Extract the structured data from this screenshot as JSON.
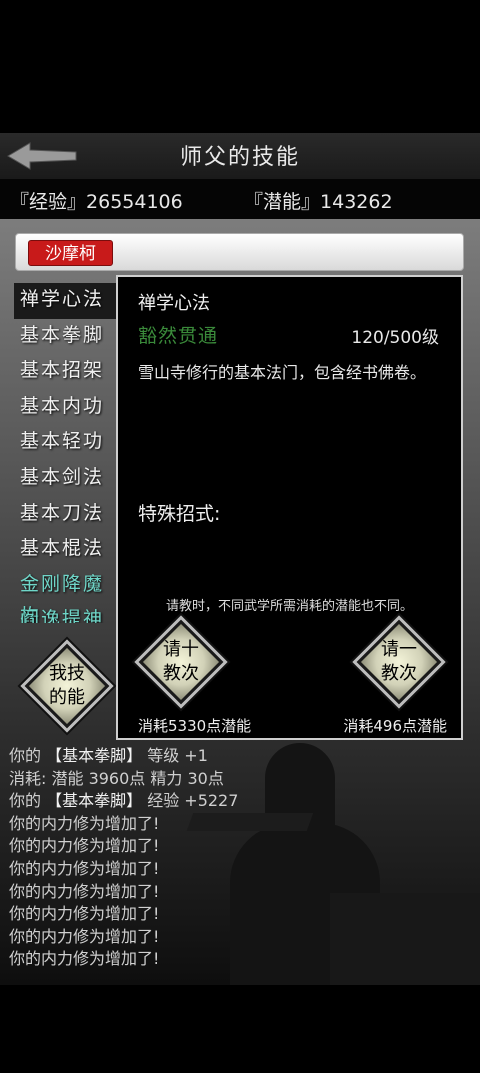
{
  "header": {
    "title": "师父的技能"
  },
  "stats": {
    "exp_label": "『经验』",
    "exp_value": "26554106",
    "pot_label": "『潜能』",
    "pot_value": "143262"
  },
  "master": {
    "name": "沙摩柯"
  },
  "skills": [
    {
      "label": "禅学心法"
    },
    {
      "label": "基本拳脚"
    },
    {
      "label": "基本招架"
    },
    {
      "label": "基本内功"
    },
    {
      "label": "基本轻功"
    },
    {
      "label": "基本剑法"
    },
    {
      "label": "基本刀法"
    },
    {
      "label": "基本棍法"
    },
    {
      "label": "金刚降魔杵"
    },
    {
      "label": "阎逸提神诀"
    }
  ],
  "my_skills_button": {
    "line1": "我技",
    "line2": "的能"
  },
  "panel": {
    "name": "禅学心法",
    "rank": "豁然贯通",
    "level": "120/500级",
    "description": "雪山寺修行的基本法门，包含经书佛卷。",
    "special_label": "特殊招式:",
    "note": "请教时，不同武学所需消耗的潜能也不同。",
    "btn_ten": {
      "line1": "请十",
      "line2": "教次",
      "cost": "消耗5330点潜能"
    },
    "btn_one": {
      "line1": "请一",
      "line2": "教次",
      "cost": "消耗496点潜能"
    }
  },
  "log": [
    {
      "a": "你的 ",
      "b": "【基本拳脚】",
      "c": " 等级 +1"
    },
    {
      "a": "消耗: 潜能 3960点  精力 30点",
      "b": "",
      "c": ""
    },
    {
      "a": "你的 ",
      "b": "【基本拳脚】",
      "c": " 经验 +5227"
    },
    {
      "a": "你的内力修为增加了!",
      "b": "",
      "c": ""
    },
    {
      "a": "你的内力修为增加了!",
      "b": "",
      "c": ""
    },
    {
      "a": "你的内力修为增加了!",
      "b": "",
      "c": ""
    },
    {
      "a": "你的内力修为增加了!",
      "b": "",
      "c": ""
    },
    {
      "a": "你的内力修为增加了!",
      "b": "",
      "c": ""
    },
    {
      "a": "你的内力修为增加了!",
      "b": "",
      "c": ""
    },
    {
      "a": "你的内力修为增加了!",
      "b": "",
      "c": ""
    }
  ]
}
